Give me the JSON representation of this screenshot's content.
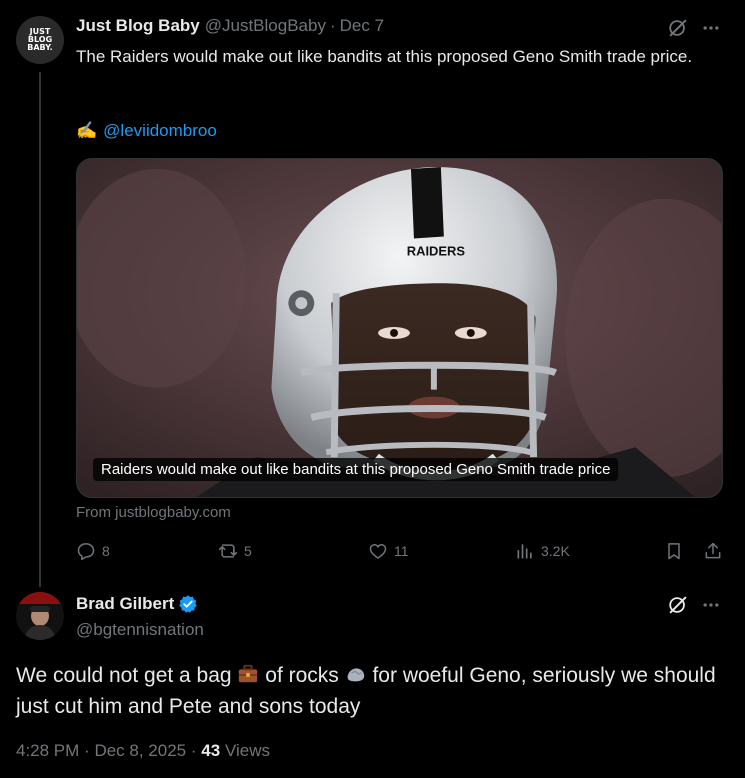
{
  "tweet1": {
    "author_name": "Just Blog Baby",
    "avatar_text": [
      "JUST",
      "BLOG",
      "BABY."
    ],
    "handle": "@JustBlogBaby",
    "separator": "·",
    "date": "Dec 7",
    "text": "The Raiders would make out like bandits at this proposed Geno Smith trade price.",
    "pencil_emoji": "✍️",
    "mention": "@leviidombroo",
    "card": {
      "helmet_text": "RAIDERS",
      "caption": "Raiders would make out like bandits at this proposed Geno Smith trade price",
      "source": "From justblogbaby.com"
    },
    "actions": {
      "replies": "8",
      "reposts": "5",
      "likes": "11",
      "views": "3.2K"
    }
  },
  "tweet2": {
    "author_name": "Brad Gilbert",
    "verified": true,
    "handle": "@bgtennisnation",
    "text_parts": [
      "We could not get a bag ",
      " of rocks ",
      " for woeful Geno, seriously we should just cut him and Pete and sons today"
    ],
    "emojis": [
      "briefcase-emoji",
      "rock-emoji"
    ],
    "time": "4:28 PM",
    "separator": "·",
    "date": "Dec 8, 2025",
    "separator2": "·",
    "views_count": "43",
    "views_label": "Views"
  },
  "colors": {
    "background": "#000000",
    "text": "#e7e9ea",
    "muted": "#71767b",
    "link": "#1d9bf0",
    "verified": "#1d9bf0"
  }
}
